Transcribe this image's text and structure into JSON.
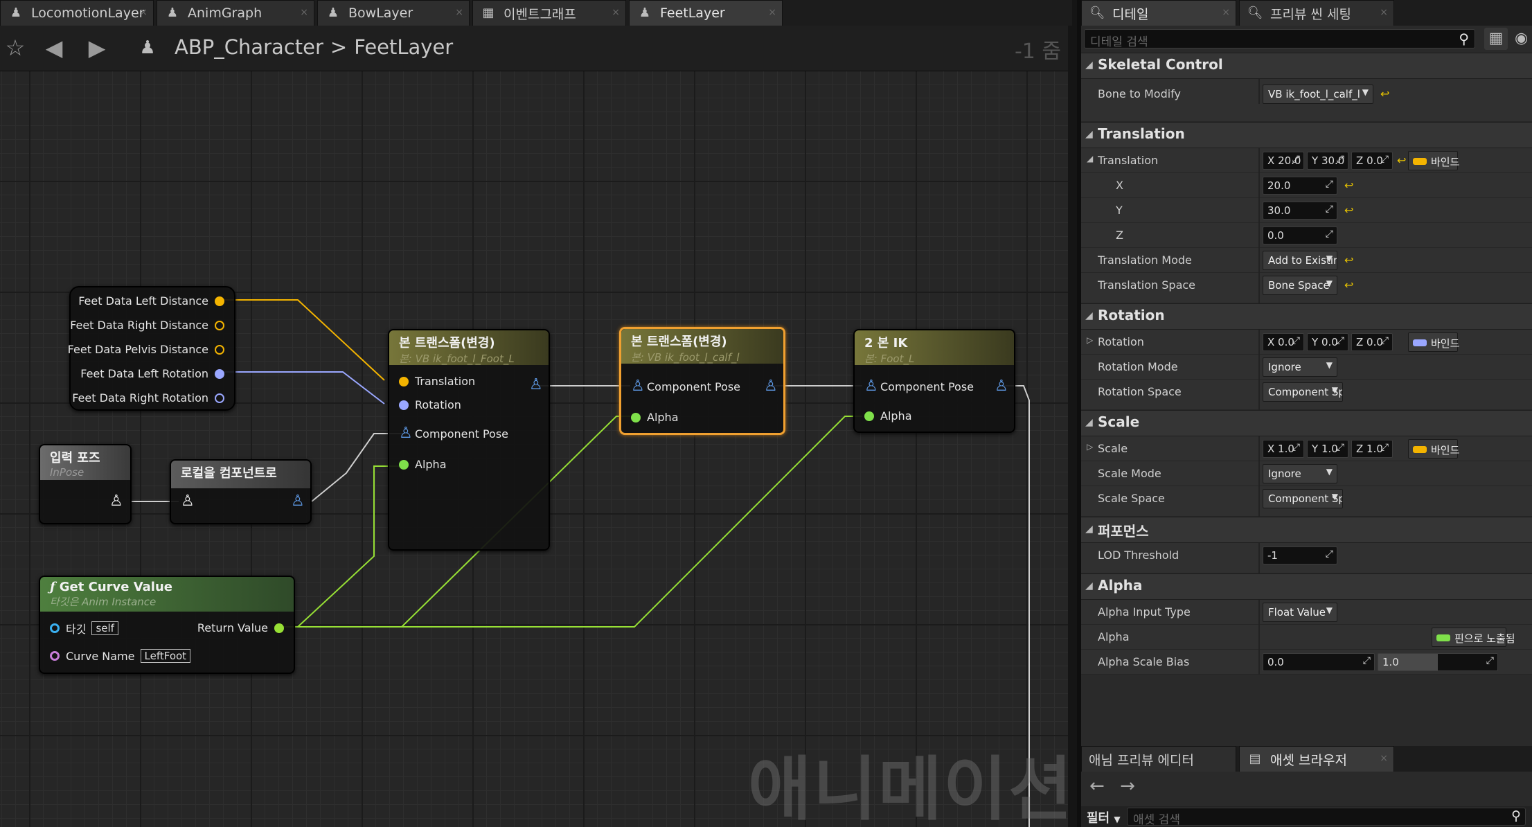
{
  "tabs": [
    {
      "label": "LocomotionLayer",
      "icon": "anim-blueprint-icon"
    },
    {
      "label": "AnimGraph",
      "icon": "anim-blueprint-icon"
    },
    {
      "label": "BowLayer",
      "icon": "anim-blueprint-icon"
    },
    {
      "label": "이벤트그래프",
      "icon": "event-graph-icon"
    },
    {
      "label": "FeetLayer",
      "icon": "anim-blueprint-icon"
    }
  ],
  "breadcrumb": {
    "root": "ABP_Character",
    "separator": ">",
    "current": "FeetLayer"
  },
  "zoom": "-1 줌",
  "watermark": "애니메이션",
  "nodes": {
    "feet_data": {
      "pins": [
        "Feet Data Left Distance",
        "Feet Data Right Distance",
        "Feet Data Pelvis Distance",
        "Feet Data Left Rotation",
        "Feet Data Right Rotation"
      ]
    },
    "input_pose": {
      "title": "입력 포즈",
      "subtitle": "InPose"
    },
    "local_to_component": {
      "title": "로컬을 컴포넌트로"
    },
    "get_curve": {
      "title": "Get Curve Value",
      "subtitle": "타깃은 Anim Instance",
      "target_label": "타깃",
      "target_value": "self",
      "return_label": "Return Value",
      "curve_label": "Curve Name",
      "curve_value": "LeftFoot"
    },
    "transform1": {
      "title": "본 트랜스폼(변경)",
      "subtitle": "본: VB ik_foot_l_Foot_L",
      "pins": [
        "Translation",
        "Rotation",
        "Component Pose",
        "Alpha"
      ]
    },
    "transform2": {
      "title": "본 트랜스폼(변경)",
      "subtitle": "본: VB ik_foot_l_calf_l",
      "pins": [
        "Component Pose",
        "Alpha"
      ]
    },
    "ik": {
      "title": "2 본 IK",
      "subtitle": "본: Foot_L",
      "pins": [
        "Component Pose",
        "Alpha"
      ]
    }
  },
  "details": {
    "tabs": [
      "디테일",
      "프리뷰 씬 세팅"
    ],
    "search_placeholder": "디테일 검색",
    "skeletal_control": {
      "header": "Skeletal Control",
      "bone_label": "Bone to Modify",
      "bone_value": "VB ik_foot_l_calf_l"
    },
    "translation": {
      "header": "Translation",
      "label": "Translation",
      "x_short": "X",
      "y_short": "Y",
      "z_short": "Z",
      "x": "20.0",
      "y": "30.0",
      "z": "0.0",
      "x_label": "X",
      "y_label": "Y",
      "z_label": "Z",
      "bind": "바인드",
      "mode_label": "Translation Mode",
      "mode_value": "Add to Existing",
      "space_label": "Translation Space",
      "space_value": "Bone Space"
    },
    "rotation": {
      "header": "Rotation",
      "label": "Rotation",
      "x": "0.0",
      "y": "0.0",
      "z": "0.0",
      "bind": "바인드",
      "mode_label": "Rotation Mode",
      "mode_value": "Ignore",
      "space_label": "Rotation Space",
      "space_value": "Component Space"
    },
    "scale": {
      "header": "Scale",
      "label": "Scale",
      "x": "1.0",
      "y": "1.0",
      "z": "1.0",
      "bind": "바인드",
      "mode_label": "Scale Mode",
      "mode_value": "Ignore",
      "space_label": "Scale Space",
      "space_value": "Component Space"
    },
    "performance": {
      "header": "퍼포먼스",
      "lod_label": "LOD Threshold",
      "lod_value": "-1"
    },
    "alpha": {
      "header": "Alpha",
      "input_type_label": "Alpha Input Type",
      "input_type_value": "Float Value",
      "alpha_label": "Alpha",
      "alpha_value": "핀으로 노출됨",
      "bias_label": "Alpha Scale Bias",
      "bias_min": "0.0",
      "bias_max": "1.0"
    }
  },
  "bottom": {
    "tabs": [
      "애님 프리뷰 에디터",
      "애셋 브라우저"
    ],
    "filter_label": "필터",
    "search_placeholder": "애셋 검색"
  },
  "colors": {
    "float_pin": "#f4b400",
    "rotator_pin": "#9aa7ff",
    "pose_pin": "#5f9be8",
    "alpha_wire": "#97e035",
    "bool_pin": "#7fe04a"
  }
}
